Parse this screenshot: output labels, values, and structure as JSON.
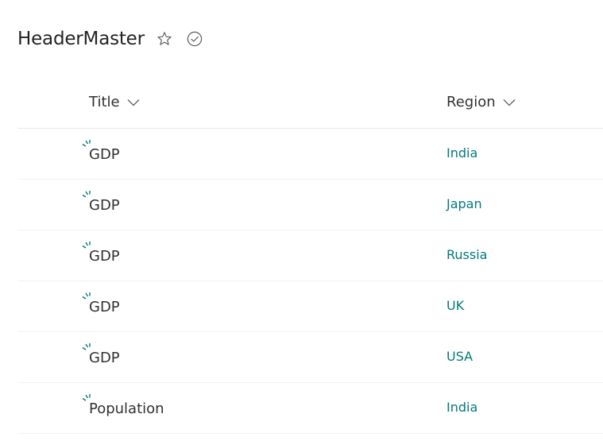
{
  "page": {
    "title": "HeaderMaster"
  },
  "columns": {
    "title_label": "Title",
    "region_label": "Region"
  },
  "icons": {
    "favorite": "star-icon",
    "follow": "check-circle-icon",
    "new_item": "new-item-burst-icon",
    "sort": "chevron-down-icon"
  },
  "colors": {
    "accent": "#03787c",
    "text": "#323130"
  },
  "rows": [
    {
      "title": "GDP",
      "region": "India"
    },
    {
      "title": "GDP",
      "region": "Japan"
    },
    {
      "title": "GDP",
      "region": "Russia"
    },
    {
      "title": "GDP",
      "region": "UK"
    },
    {
      "title": "GDP",
      "region": "USA"
    },
    {
      "title": "Population",
      "region": "India"
    }
  ]
}
